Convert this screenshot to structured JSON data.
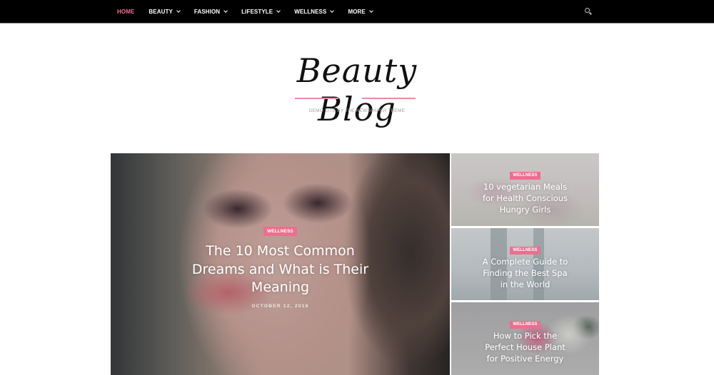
{
  "nav": {
    "items": [
      {
        "label": "HOME",
        "active": true,
        "has_dropdown": false
      },
      {
        "label": "BEAUTY",
        "active": false,
        "has_dropdown": true
      },
      {
        "label": "FASHION",
        "active": false,
        "has_dropdown": true
      },
      {
        "label": "LIFESTYLE",
        "active": false,
        "has_dropdown": true
      },
      {
        "label": "WELLNESS",
        "active": false,
        "has_dropdown": true
      },
      {
        "label": "MORE",
        "active": false,
        "has_dropdown": true
      }
    ],
    "search_icon": "search-icon"
  },
  "header": {
    "logo_text": "Beauty Blog",
    "tagline": "DEMO SITE BY THE NEWSPAPER THEME"
  },
  "colors": {
    "accent": "#ef6d8f",
    "nav_active": "#f16e93",
    "topbar": "#000000"
  },
  "featured": {
    "main": {
      "category": "WELLNESS",
      "title": "The 10 Most Common Dreams and What is Their Meaning",
      "date": "OCTOBER 12, 2016"
    },
    "side": [
      {
        "category": "WELLNESS",
        "title": "10 vegetarian Meals for Health Conscious Hungry Girls"
      },
      {
        "category": "WELLNESS",
        "title": "A Complete Guide to Finding the Best Spa in the World"
      },
      {
        "category": "WELLNESS",
        "title": "How to Pick the Perfect House Plant for Positive Energy"
      }
    ]
  }
}
